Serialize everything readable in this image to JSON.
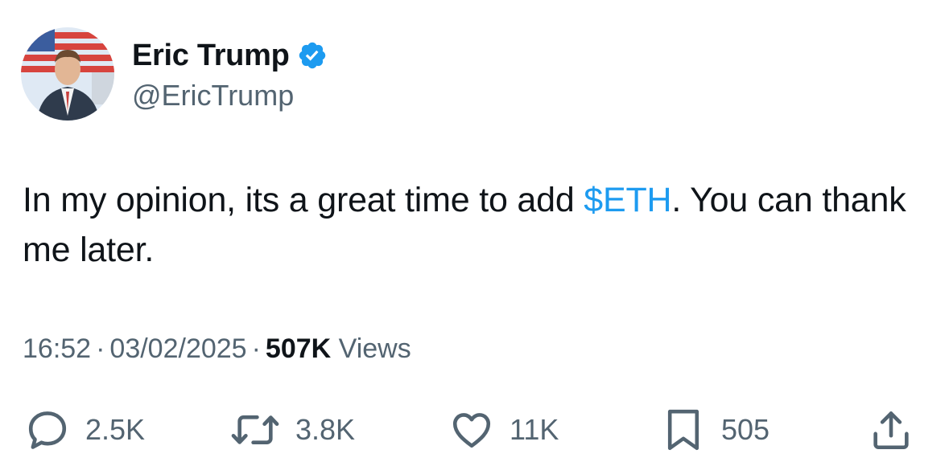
{
  "author": {
    "display_name": "Eric Trump",
    "handle": "@EricTrump",
    "verified": true,
    "verified_color": "#1d9bf0"
  },
  "tweet": {
    "text_before": "In my opinion, its a great time to add ",
    "cashtag": "$ETH",
    "text_after": ". You can thank me later.",
    "cashtag_color": "#1d9bf0"
  },
  "meta": {
    "time": "16:52",
    "separator": "·",
    "date": "03/02/2025",
    "views_count": "507K",
    "views_label": "Views"
  },
  "actions": {
    "replies": "2.5K",
    "reposts": "3.8K",
    "likes": "11K",
    "bookmarks": "505"
  },
  "icons": {
    "reply": "reply-icon",
    "repost": "repost-icon",
    "like": "like-icon",
    "bookmark": "bookmark-icon",
    "share": "share-icon",
    "verified": "verified-badge-icon"
  }
}
